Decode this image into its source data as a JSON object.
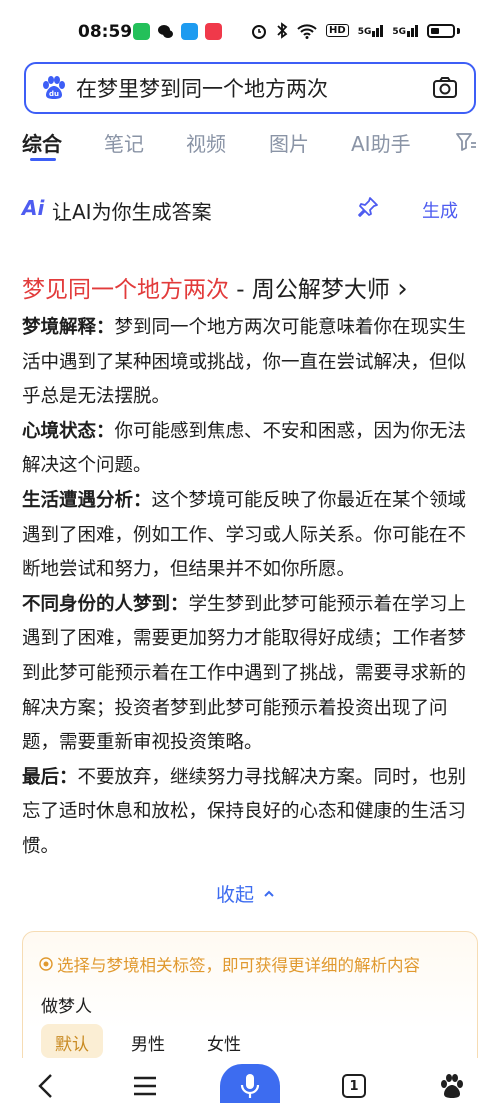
{
  "status_bar": {
    "time": "08:59",
    "signal_1": "5G",
    "signal_2": "5G",
    "hd_badge": "HD"
  },
  "search": {
    "query": "在梦里梦到同一个地方两次"
  },
  "tabs": [
    {
      "label": "综合",
      "active": true
    },
    {
      "label": "笔记",
      "active": false
    },
    {
      "label": "视频",
      "active": false
    },
    {
      "label": "图片",
      "active": false
    },
    {
      "label": "AI助手",
      "active": false
    },
    {
      "label": "T=",
      "active": false
    }
  ],
  "ai_bar": {
    "logo": "Ai",
    "text": "让AI为你生成答案",
    "generate_label": "生成"
  },
  "result": {
    "title_highlight": "梦见同一个地方两次",
    "title_rest": " - 周公解梦大师",
    "chevron": "›",
    "sections": [
      {
        "label": "梦境解释：",
        "text": "梦到同一个地方两次可能意味着你在现实生活中遇到了某种困境或挑战，你一直在尝试解决，但似乎总是无法摆脱。"
      },
      {
        "label": "心境状态：",
        "text": "你可能感到焦虑、不安和困惑，因为你无法解决这个问题。"
      },
      {
        "label": "生活遭遇分析：",
        "text": "这个梦境可能反映了你最近在某个领域遇到了困难，例如工作、学习或人际关系。你可能在不断地尝试和努力，但结果并不如你所愿。"
      },
      {
        "label": "不同身份的人梦到：",
        "text": "学生梦到此梦可能预示着在学习上遇到了困难，需要更加努力才能取得好成绩；工作者梦到此梦可能预示着在工作中遇到了挑战，需要寻求新的解决方案；投资者梦到此梦可能预示着投资出现了问题，需要重新审视投资策略。"
      },
      {
        "label": "最后：",
        "text": "不要放弃，继续努力寻找解决方案。同时，也别忘了适时休息和放松，保持良好的心态和健康的生活习惯。"
      }
    ],
    "collapse_label": "收起"
  },
  "tag_card": {
    "hint": "选择与梦境相关标签，即可获得更详细的解析内容",
    "label": "做梦人",
    "options": [
      {
        "label": "默认",
        "selected": true
      },
      {
        "label": "男性",
        "selected": false
      },
      {
        "label": "女性",
        "selected": false
      }
    ]
  },
  "bottom_nav": {
    "tab_count": "1"
  },
  "colors": {
    "accent": "#3d6cf0",
    "title_red": "#e23b3b",
    "hint_orange": "#e0992f"
  }
}
